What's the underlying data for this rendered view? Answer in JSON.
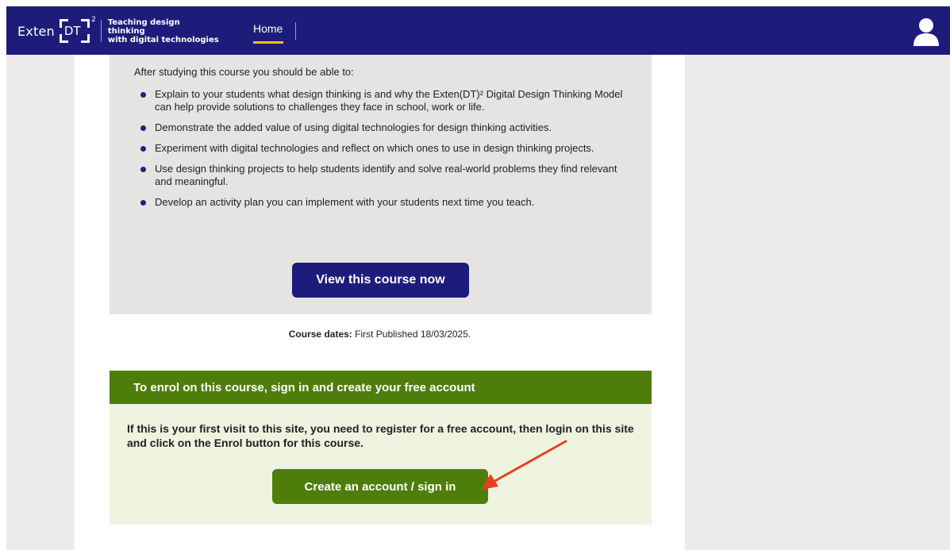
{
  "header": {
    "logo": {
      "word": "Exten",
      "mark": "DT",
      "superscript": "2"
    },
    "tagline": [
      "Teaching design thinking",
      "with digital technologies"
    ],
    "nav": {
      "home_label": "Home"
    },
    "icons": {
      "user": "user-icon"
    },
    "colors": {
      "bar": "#1e1c7b",
      "active_underline": "#f2c200"
    }
  },
  "outcomes": {
    "intro": "After studying this course you should be able to:",
    "items": [
      "Explain to your students what design thinking is and why the Exten(DT)² Digital Design Thinking Model can help provide solutions to challenges they face in school, work or life.",
      "Demonstrate the added value of using digital technologies for design thinking activities.",
      "Experiment with digital technologies and reflect on which ones to use in design thinking projects.",
      "Use design thinking projects to help students identify and solve real-world problems they find relevant and meaningful.",
      "Develop an activity plan you can implement with your students next time you teach."
    ],
    "view_button": "View this course now"
  },
  "course_dates": {
    "label": "Course dates:",
    "value": " First Published 18/03/2025."
  },
  "enrol": {
    "heading": "To enrol on this course, sign in and create your free account",
    "body": "If this is your first visit to this site, you need to register for a free account, then login on this site and click on the Enrol button for this course.",
    "button": "Create an account / sign in",
    "colors": {
      "header": "#4e7d0b",
      "panel": "#eef3df",
      "annotation_arrow": "#e8401f"
    }
  }
}
